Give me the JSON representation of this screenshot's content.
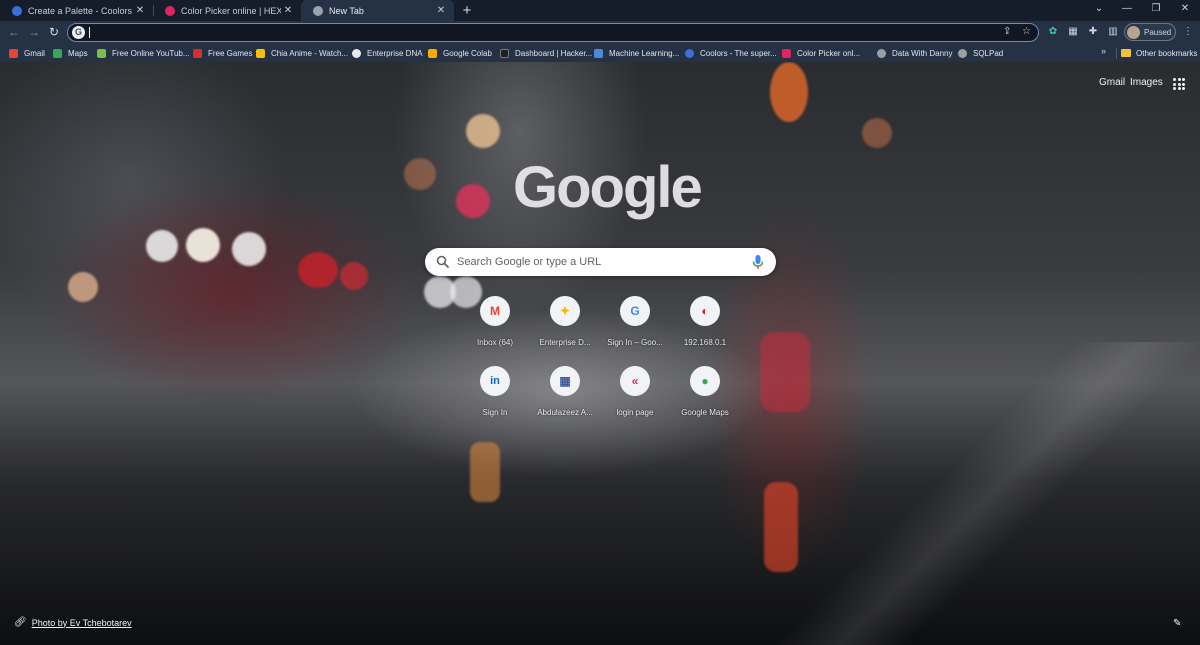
{
  "tabs": [
    {
      "title": "Create a Palette - Coolors",
      "favicon": "coolors-icon",
      "color": "#3a6fd8"
    },
    {
      "title": "Color Picker online | HEX Color",
      "favicon": "color-picker-icon",
      "color": "#e0245e"
    },
    {
      "title": "New Tab",
      "favicon": "new-tab-icon",
      "color": "#9aa3ad",
      "active": true
    }
  ],
  "toolbar": {
    "omnibox_value": "",
    "profile_label": "Paused"
  },
  "bookmarks": [
    {
      "label": "Gmail",
      "color": "#ea4335"
    },
    {
      "label": "Maps",
      "color": "#34a853"
    },
    {
      "label": "Free Online YouTub...",
      "color": "#7bc043"
    },
    {
      "label": "Free Games",
      "color": "#d93025"
    },
    {
      "label": "Chia Anime - Watch...",
      "color": "#f4c20d"
    },
    {
      "label": "Enterprise DNA",
      "color": "#e8eaed"
    },
    {
      "label": "Google Colab",
      "color": "#f9ab00"
    },
    {
      "label": "Dashboard | Hacker...",
      "color": "#1f1f1f"
    },
    {
      "label": "Machine Learning...",
      "color": "#4f87d9"
    },
    {
      "label": "Coolors - The super...",
      "color": "#3a6fd8"
    },
    {
      "label": "Color Picker onl...",
      "color": "#e0245e"
    },
    {
      "label": "Data With Danny",
      "color": "#9aa0a6"
    },
    {
      "label": "SQLPad",
      "color": "#9aa0a6"
    }
  ],
  "other_bookmarks": "Other bookmarks",
  "top_links": {
    "gmail": "Gmail",
    "images": "Images"
  },
  "logo_text": "Google",
  "search": {
    "placeholder": "Search Google or type a URL"
  },
  "shortcuts": [
    {
      "label": "Inbox (64)",
      "glyph": "M",
      "color": "#ea4335"
    },
    {
      "label": "Enterprise D...",
      "glyph": "✦",
      "color": "#f4b400"
    },
    {
      "label": "Sign In – Goo...",
      "glyph": "G",
      "color": "#4285f4"
    },
    {
      "label": "192.168.0.1",
      "glyph": "◐",
      "color": "#e31b23"
    },
    {
      "label": "Sign In",
      "glyph": "in",
      "color": "#0a66c2"
    },
    {
      "label": "Abdulazeez A...",
      "glyph": "▦",
      "color": "#3d5a98"
    },
    {
      "label": "login page",
      "glyph": "«",
      "color": "#e0245e"
    },
    {
      "label": "Google Maps",
      "glyph": "●",
      "color": "#34a853"
    }
  ],
  "photo_credit": "Photo by Ev Tchebotarev"
}
